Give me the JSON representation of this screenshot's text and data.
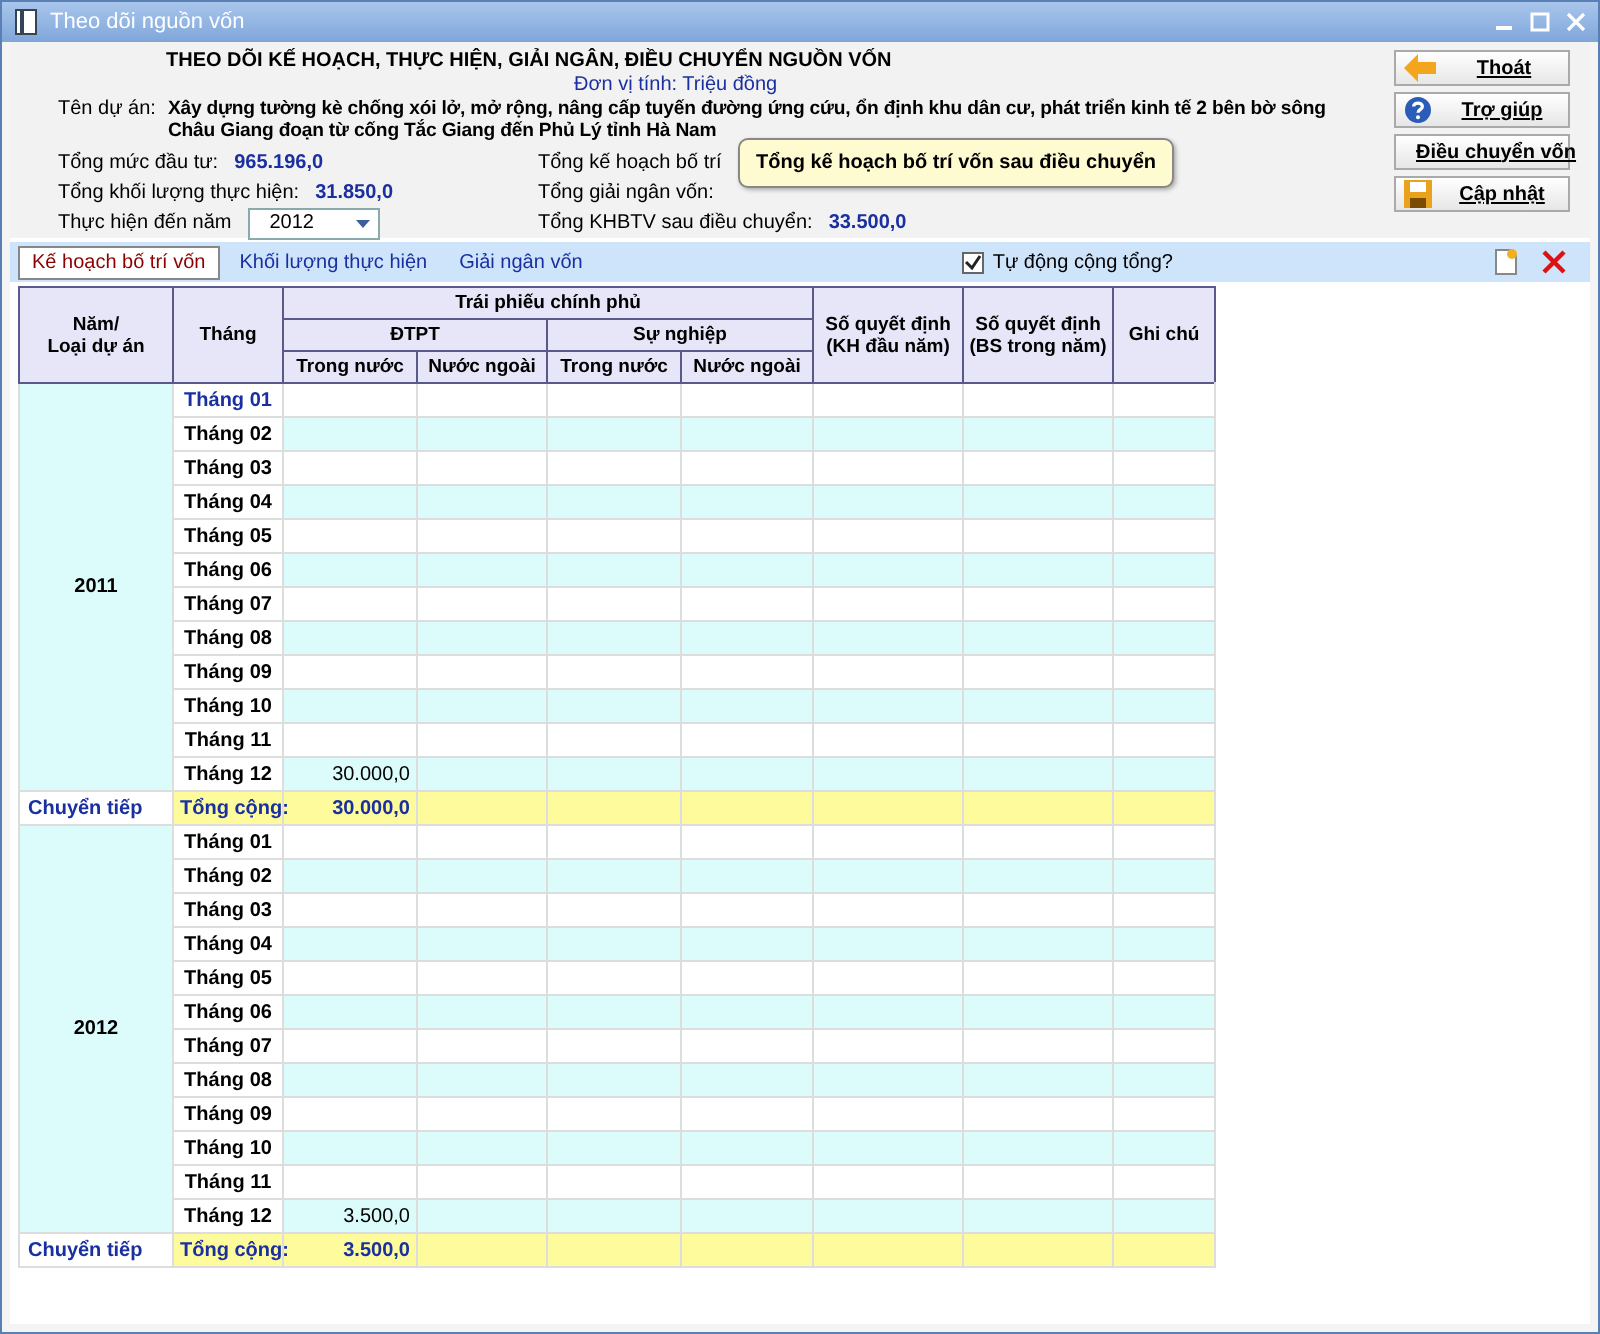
{
  "window": {
    "title": "Theo dõi nguồn vốn"
  },
  "header": {
    "title": "THEO DÕI KẾ HOẠCH, THỰC HIỆN, GIẢI NGÂN, ĐIỀU CHUYỂN NGUỒN VỐN",
    "unit": "Đơn vị tính: Triệu đồng",
    "project_label": "Tên dự án:",
    "project_name": "Xây dựng tường kè chống xói lở, mở rộng, nâng cấp tuyến đường ứng cứu, ổn định khu dân cư, phát triển kinh tế 2 bên bờ sông Châu Giang đoạn từ cống Tắc Giang đến Phủ Lý tỉnh Hà Nam"
  },
  "left_fields": [
    {
      "label": "Tổng mức đầu tư:",
      "value": "965.196,0"
    },
    {
      "label": "Tổng khối lượng thực hiện:",
      "value": "31.850,0"
    }
  ],
  "year_field": {
    "label": "Thực hiện đến năm",
    "value": "2012"
  },
  "right_fields": [
    {
      "label": "Tổng kế hoạch bố trí"
    },
    {
      "label": "Tổng giải ngân vốn:"
    },
    {
      "label": "Tổng KHBTV sau điều chuyển:",
      "value": "33.500,0"
    }
  ],
  "tooltip": "Tổng kế hoạch bố trí vốn sau điều chuyển",
  "buttons": [
    {
      "label": "Thoát",
      "kind": "exit"
    },
    {
      "label": "Trợ giúp",
      "kind": "help"
    },
    {
      "label": "Điều chuyển vốn",
      "kind": "transfer"
    },
    {
      "label": "Cập nhật",
      "kind": "save"
    }
  ],
  "tabs": [
    {
      "label": "Kế hoạch bố trí vốn",
      "selected": true
    },
    {
      "label": "Khối lượng thực hiện",
      "selected": false
    },
    {
      "label": "Giải ngân vốn",
      "selected": false
    }
  ],
  "auto_sum": {
    "label": "Tự động cộng tổng?",
    "checked": true
  },
  "table": {
    "col_year": "Năm/\nLoại dự án",
    "col_month": "Tháng",
    "group": "Trái phiếu chính phủ",
    "sub1": "ĐTPT",
    "sub2": "Sự nghiệp",
    "leaf": [
      "Trong nước",
      "Nước ngoài",
      "Trong nước",
      "Nước ngoài"
    ],
    "col_qd1": "Số quyết định\n(KH đầu năm)",
    "col_qd2": "Số quyết định\n(BS trong năm)",
    "col_note": "Ghi chú",
    "years": [
      {
        "year": "2011",
        "carry": "Chuyển tiếp",
        "total_label": "Tổng cộng:",
        "total": "30.000,0",
        "months": [
          {
            "label": "Tháng 01",
            "selected": true
          },
          {
            "label": "Tháng 02",
            "selected": false
          },
          {
            "label": "Tháng 03",
            "selected": false
          },
          {
            "label": "Tháng 04",
            "selected": false
          },
          {
            "label": "Tháng 05",
            "selected": false
          },
          {
            "label": "Tháng 06",
            "selected": false
          },
          {
            "label": "Tháng 07",
            "selected": false
          },
          {
            "label": "Tháng 08",
            "selected": false
          },
          {
            "label": "Tháng 09",
            "selected": false
          },
          {
            "label": "Tháng 10",
            "selected": false
          },
          {
            "label": "Tháng 11",
            "selected": false
          },
          {
            "label": "Tháng 12",
            "selected": false,
            "value": "30.000,0"
          }
        ]
      },
      {
        "year": "2012",
        "carry": "Chuyển tiếp",
        "total_label": "Tổng cộng:",
        "total": "3.500,0",
        "months": [
          {
            "label": "Tháng 01",
            "selected": false
          },
          {
            "label": "Tháng 02",
            "selected": false
          },
          {
            "label": "Tháng 03",
            "selected": false
          },
          {
            "label": "Tháng 04",
            "selected": false
          },
          {
            "label": "Tháng 05",
            "selected": false
          },
          {
            "label": "Tháng 06",
            "selected": false
          },
          {
            "label": "Tháng 07",
            "selected": false
          },
          {
            "label": "Tháng 08",
            "selected": false
          },
          {
            "label": "Tháng 09",
            "selected": false
          },
          {
            "label": "Tháng 10",
            "selected": false
          },
          {
            "label": "Tháng 11",
            "selected": false
          },
          {
            "label": "Tháng 12",
            "selected": false,
            "value": "3.500,0"
          }
        ]
      }
    ]
  }
}
